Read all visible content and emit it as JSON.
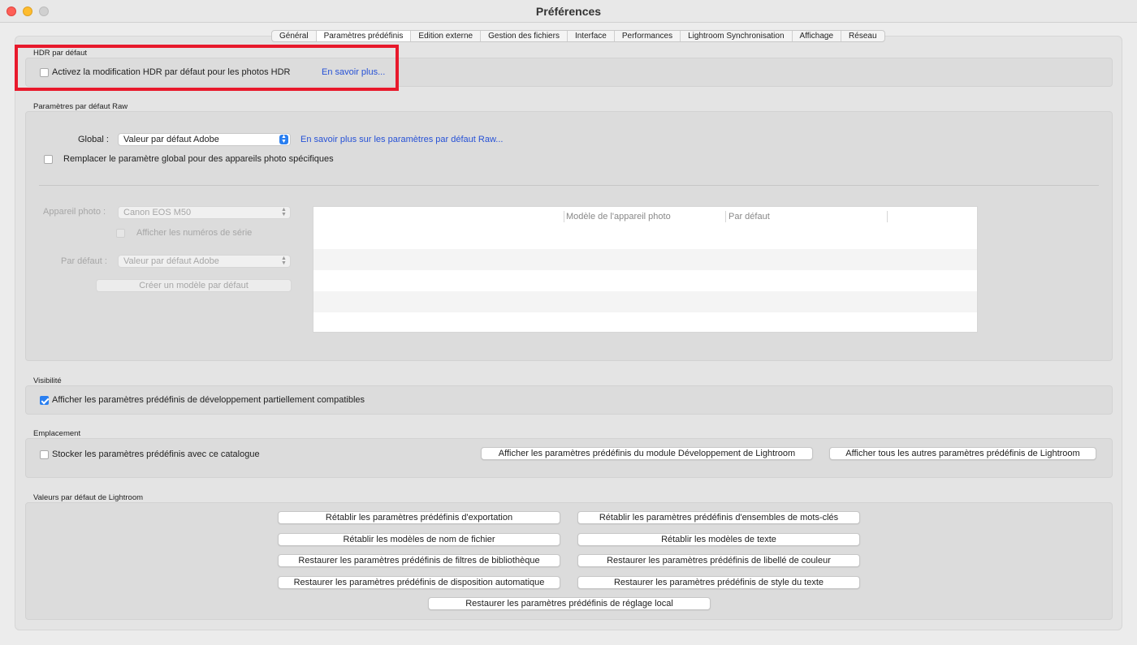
{
  "window": {
    "title": "Préférences"
  },
  "tabs": [
    {
      "label": "Général",
      "active": false
    },
    {
      "label": "Paramètres prédéfinis",
      "active": true
    },
    {
      "label": "Edition externe",
      "active": false
    },
    {
      "label": "Gestion des fichiers",
      "active": false
    },
    {
      "label": "Interface",
      "active": false
    },
    {
      "label": "Performances",
      "active": false
    },
    {
      "label": "Lightroom Synchronisation",
      "active": false
    },
    {
      "label": "Affichage",
      "active": false
    },
    {
      "label": "Réseau",
      "active": false
    }
  ],
  "hdr": {
    "group_label": "HDR par défaut",
    "checkbox_label": "Activez la modification HDR par défaut pour les photos HDR",
    "checked": false,
    "learn_more": "En savoir plus..."
  },
  "raw": {
    "group_label": "Paramètres par défaut Raw",
    "global_label": "Global :",
    "global_value": "Valeur par défaut Adobe",
    "learn_more": "En savoir plus sur les paramètres par défaut Raw...",
    "override_label": "Remplacer le paramètre global pour des appareils photo spécifiques",
    "camera_label": "Appareil photo :",
    "camera_value": "Canon EOS M50",
    "serial_label": "Afficher les numéros de série",
    "default_label": "Par défaut :",
    "default_value": "Valeur par défaut Adobe",
    "create_button": "Créer un modèle par défaut",
    "table_headers": [
      "Modèle de l'appareil photo",
      "Par défaut"
    ]
  },
  "visibility": {
    "group_label": "Visibilité",
    "checkbox_label": "Afficher les paramètres prédéfinis de développement partiellement compatibles",
    "checked": true
  },
  "location": {
    "group_label": "Emplacement",
    "checkbox_label": "Stocker les paramètres prédéfinis avec ce catalogue",
    "checked": false,
    "show_develop_button": "Afficher les paramètres prédéfinis du module Développement de Lightroom",
    "show_all_button": "Afficher tous les autres paramètres prédéfinis de Lightroom"
  },
  "defaults": {
    "group_label": "Valeurs par défaut de Lightroom",
    "buttons": [
      "Rétablir les paramètres prédéfinis d'exportation",
      "Rétablir les paramètres prédéfinis d'ensembles de mots-clés",
      "Rétablir les modèles de nom de fichier",
      "Rétablir les modèles de texte",
      "Restaurer les paramètres prédéfinis de filtres de bibliothèque",
      "Restaurer les paramètres prédéfinis de libellé de couleur",
      "Restaurer les paramètres prédéfinis de disposition automatique",
      "Restaurer les paramètres prédéfinis de style du texte",
      "Restaurer les paramètres prédéfinis de réglage local"
    ]
  }
}
